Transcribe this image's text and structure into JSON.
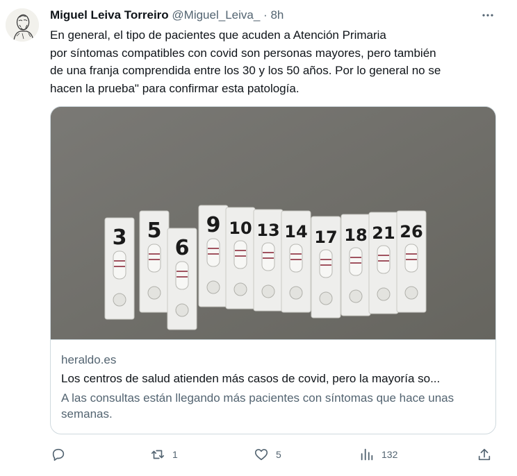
{
  "tweet": {
    "author_name": "Miguel Leiva Torreiro",
    "handle": "@Miguel_Leiva_",
    "separator": "·",
    "time": "8h",
    "text_lines": [
      "En general, el tipo de pacientes que acuden a Atención Primaria",
      "por síntomas compatibles con covid son personas mayores, pero también",
      "de una franja comprendida entre los 30 y los 50 años. Por lo general no se",
      "hacen la prueba\" para confirmar esta patología."
    ]
  },
  "card": {
    "domain": "heraldo.es",
    "title": "Los centros de salud atienden más casos de covid, pero la mayoría so...",
    "description": "A las consultas están llegando más pacientes con síntomas que hace unas semanas.",
    "image_labels": [
      "3",
      "5",
      "6",
      "9",
      "10",
      "13",
      "14",
      "17",
      "18",
      "21",
      "26"
    ]
  },
  "actions": {
    "reply": {
      "icon": "reply-icon",
      "count": ""
    },
    "retweet": {
      "icon": "retweet-icon",
      "count": "1"
    },
    "like": {
      "icon": "heart-icon",
      "count": "5"
    },
    "views": {
      "icon": "views-icon",
      "count": "132"
    },
    "share": {
      "icon": "share-icon",
      "count": ""
    }
  },
  "colors": {
    "text": "#0f1419",
    "secondary": "#536471",
    "border": "#cfd9de"
  }
}
